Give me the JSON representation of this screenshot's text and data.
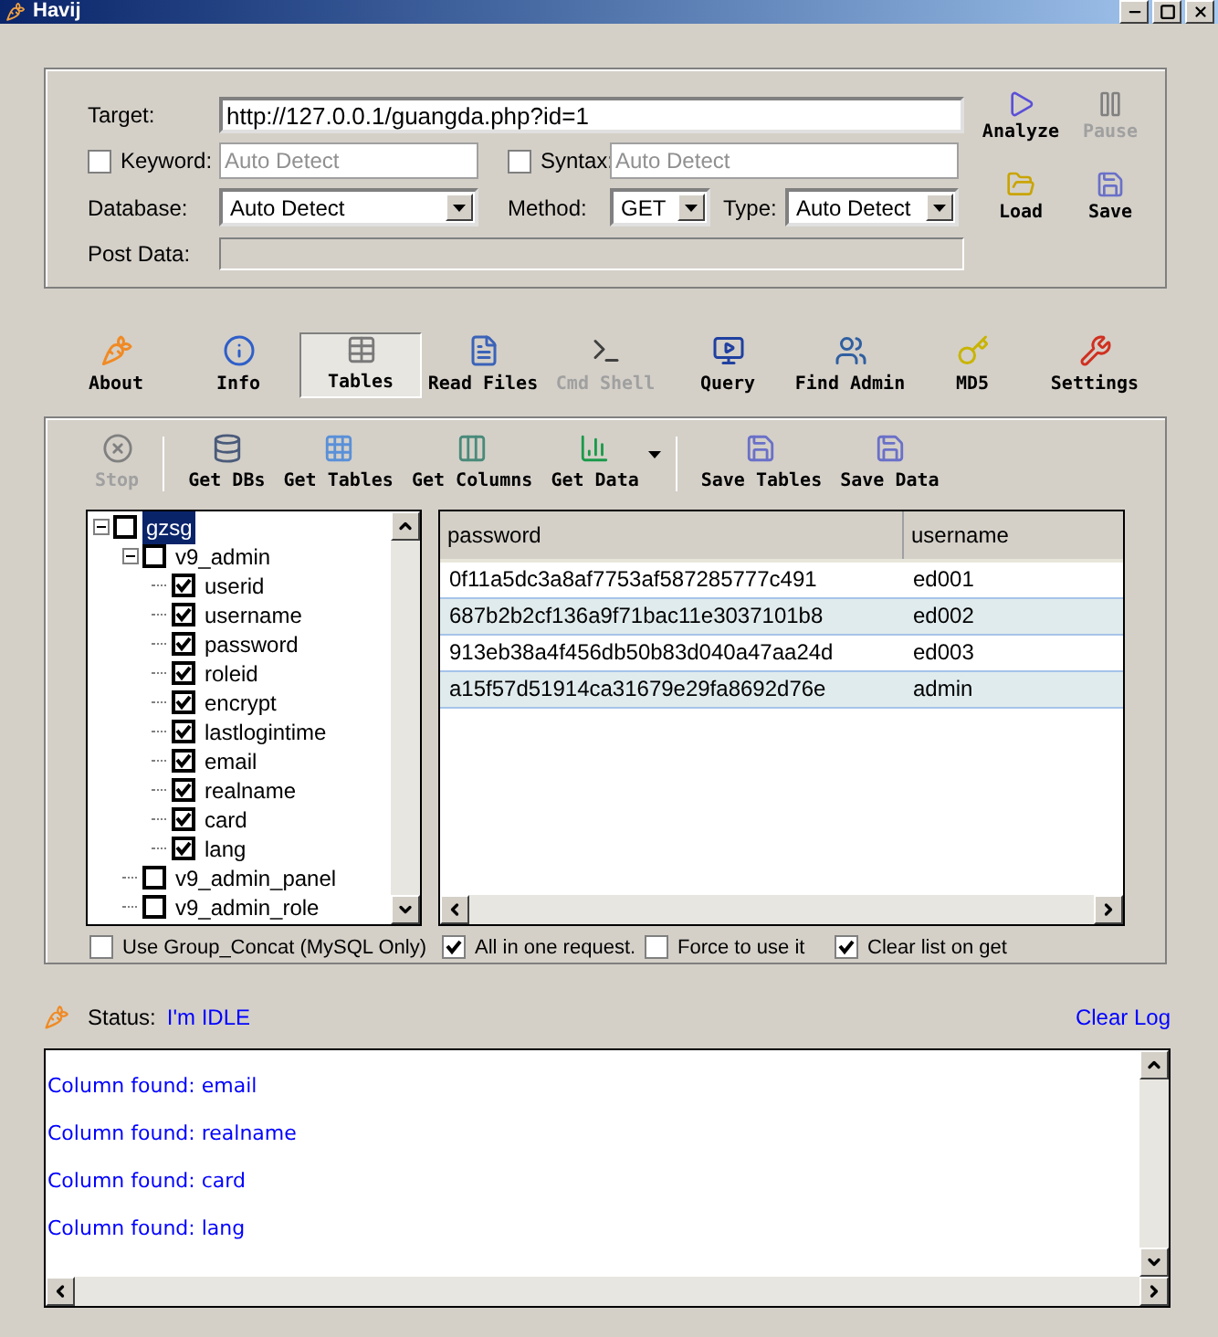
{
  "window": {
    "title": "Havij"
  },
  "target_form": {
    "target": {
      "label": "Target:",
      "value": "http://127.0.0.1/guangda.php?id=1"
    },
    "keyword": {
      "label": "Keyword:",
      "checked": false,
      "placeholder": "Auto Detect"
    },
    "syntax": {
      "label": "Syntax:",
      "checked": false,
      "placeholder": "Auto Detect"
    },
    "database": {
      "label": "Database:",
      "value": "Auto Detect"
    },
    "method": {
      "label": "Method:",
      "value": "GET"
    },
    "type": {
      "label": "Type:",
      "value": "Auto Detect"
    },
    "post_data": {
      "label": "Post Data:"
    }
  },
  "side_buttons": [
    {
      "label": "Analyze",
      "disabled": false
    },
    {
      "label": "Pause",
      "disabled": true
    },
    {
      "label": "Load",
      "disabled": false
    },
    {
      "label": "Save",
      "disabled": false
    }
  ],
  "main_toolbar": [
    {
      "label": "About",
      "selected": false,
      "disabled": false
    },
    {
      "label": "Info",
      "selected": false,
      "disabled": false
    },
    {
      "label": "Tables",
      "selected": true,
      "disabled": false
    },
    {
      "label": "Read Files",
      "selected": false,
      "disabled": false
    },
    {
      "label": "Cmd Shell",
      "selected": false,
      "disabled": true
    },
    {
      "label": "Query",
      "selected": false,
      "disabled": false
    },
    {
      "label": "Find Admin",
      "selected": false,
      "disabled": false
    },
    {
      "label": "MD5",
      "selected": false,
      "disabled": false
    },
    {
      "label": "Settings",
      "selected": false,
      "disabled": false
    }
  ],
  "data_toolbar": [
    {
      "label": "Stop",
      "disabled": true,
      "dropdown": false
    },
    {
      "label": "Get DBs",
      "disabled": false,
      "dropdown": false
    },
    {
      "label": "Get Tables",
      "disabled": false,
      "dropdown": false
    },
    {
      "label": "Get Columns",
      "disabled": false,
      "dropdown": false
    },
    {
      "label": "Get Data",
      "disabled": false,
      "dropdown": true
    },
    {
      "label": "Save Tables",
      "disabled": false,
      "dropdown": false
    },
    {
      "label": "Save Data",
      "disabled": false,
      "dropdown": false
    }
  ],
  "tree": [
    {
      "label": "gzsg",
      "checked": false,
      "selected": true,
      "expanded": true,
      "children": [
        {
          "label": "v9_admin",
          "checked": false,
          "selected": false,
          "expanded": true,
          "children": [
            {
              "label": "userid",
              "checked": true,
              "selected": false
            },
            {
              "label": "username",
              "checked": true,
              "selected": false
            },
            {
              "label": "password",
              "checked": true,
              "selected": false
            },
            {
              "label": "roleid",
              "checked": true,
              "selected": false
            },
            {
              "label": "encrypt",
              "checked": true,
              "selected": false
            },
            {
              "label": "lastlogintime",
              "checked": true,
              "selected": false
            },
            {
              "label": "email",
              "checked": true,
              "selected": false
            },
            {
              "label": "realname",
              "checked": true,
              "selected": false
            },
            {
              "label": "card",
              "checked": true,
              "selected": false
            },
            {
              "label": "lang",
              "checked": true,
              "selected": false
            }
          ]
        },
        {
          "label": "v9_admin_panel",
          "checked": false,
          "selected": false
        },
        {
          "label": "v9_admin_role",
          "checked": false,
          "selected": false
        }
      ]
    }
  ],
  "table": {
    "columns": [
      "password",
      "username"
    ],
    "rows": [
      [
        "0f11a5dc3a8af7753af587285777c491",
        "ed001"
      ],
      [
        "687b2b2cf136a9f71bac11e3037101b8",
        "ed002"
      ],
      [
        "913eb38a4f456db50b83d040a47aa24d",
        "ed003"
      ],
      [
        "a15f57d51914ca31679e29fa8692d76e",
        "admin"
      ]
    ]
  },
  "options": [
    {
      "label": "Use Group_Concat (MySQL Only)",
      "checked": false
    },
    {
      "label": "All in one request.",
      "checked": true
    },
    {
      "label": "Force to use it",
      "checked": false
    },
    {
      "label": "Clear list on get",
      "checked": true
    }
  ],
  "status": {
    "label": "Status:",
    "value": "I'm IDLE",
    "clear_link": "Clear Log"
  },
  "log": [
    "Column found: email",
    "Column found: realname",
    "Column found: card",
    "Column found: lang"
  ]
}
